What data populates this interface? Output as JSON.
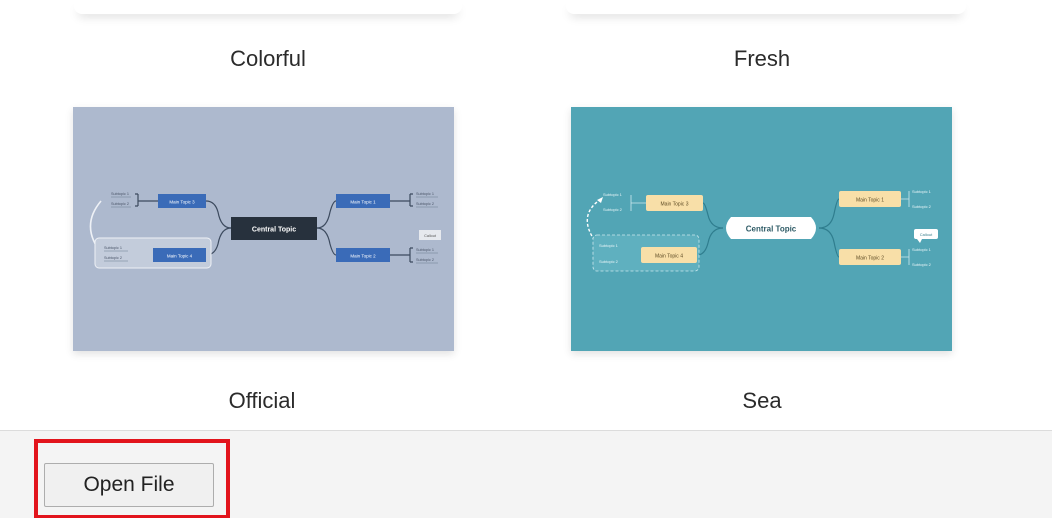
{
  "themes": [
    {
      "label": "Colorful"
    },
    {
      "label": "Fresh"
    },
    {
      "label": "Official",
      "preview": {
        "central": "Central Topic",
        "main_topics": [
          "Main Topic 3",
          "Main Topic 1",
          "Main Topic 4",
          "Main Topic 2"
        ],
        "subtopics": [
          "Subtopic 1",
          "Subtopic 2"
        ],
        "callout": "Callout",
        "colors": {
          "background": "#adb9ce",
          "central": "#27313d",
          "main": "#3a6bb8"
        }
      }
    },
    {
      "label": "Sea",
      "preview": {
        "central": "Central Topic",
        "main_topics": [
          "Main Topic 3",
          "Main Topic 1",
          "Main Topic 4",
          "Main Topic 2"
        ],
        "subtopics": [
          "Subtopic 1",
          "Subtopic 2"
        ],
        "callout": "Callout",
        "colors": {
          "background": "#52a5b5",
          "central": "#ffffff",
          "main": "#f8dfa8"
        }
      }
    }
  ],
  "footer": {
    "open_file_label": "Open File"
  }
}
